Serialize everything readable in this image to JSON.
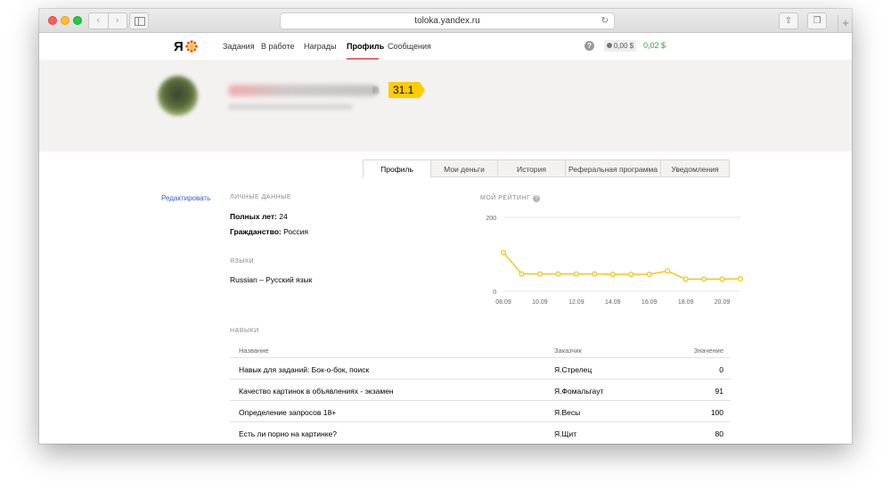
{
  "browser": {
    "url": "toloka.yandex.ru",
    "nav_back": "‹",
    "nav_forward": "›",
    "reload_glyph": "↻",
    "share_glyph": "⇧",
    "tabs_glyph": "❐",
    "new_tab_glyph": "+"
  },
  "header": {
    "logo": "Я",
    "nav": [
      "Задания",
      "В работе",
      "Награды",
      "Профиль",
      "Сообщения"
    ],
    "active_nav": "Профиль",
    "help": "?",
    "balance": "0,00 $",
    "earned": "0,02 $"
  },
  "profile": {
    "rating": "31.1",
    "name_suffix": "в",
    "tabs": [
      "Профиль",
      "Мои деньги",
      "История",
      "Реферальная программа",
      "Уведомления"
    ],
    "active_tab": "Профиль"
  },
  "sidebar": {
    "edit": "Редактировать"
  },
  "personal": {
    "label": "Личные данные",
    "age_label": "Полных лет:",
    "age_value": "24",
    "citizenship_label": "Гражданство:",
    "citizenship_value": "Россия"
  },
  "languages": {
    "label": "Языки",
    "value": "Russian – Русский язык"
  },
  "rating_chart_label": "Мой рейтинг",
  "chart_data": {
    "type": "line",
    "title": "Мой рейтинг",
    "x": [
      "08.09",
      "09.09",
      "10.09",
      "11.09",
      "12.09",
      "13.09",
      "14.09",
      "15.09",
      "16.09",
      "17.09",
      "18.09",
      "19.09",
      "20.09",
      "21.09"
    ],
    "x_tick_labels": [
      "08.09",
      "10.09",
      "12.09",
      "14.09",
      "16.09",
      "18.09",
      "20.09"
    ],
    "y_tick_labels": [
      "200",
      "0"
    ],
    "values": [
      105,
      47,
      47,
      47,
      47,
      47,
      46,
      46,
      46,
      55,
      33,
      33,
      33,
      34
    ],
    "ylim": [
      0,
      200
    ],
    "grid": true,
    "color": "#f5c518"
  },
  "skills": {
    "label": "Навыки",
    "columns": [
      "Название",
      "Заказчик",
      "Значение"
    ],
    "rows": [
      {
        "name": "Навык для заданий: Бок-о-бок, поиск",
        "customer": "Я.Стрелец",
        "value": "0"
      },
      {
        "name": "Качество картинок в объявлениях - экзамен",
        "customer": "Я.Фомальгаут",
        "value": "91"
      },
      {
        "name": "Определение запросов 18+",
        "customer": "Я.Весы",
        "value": "100"
      },
      {
        "name": "Есть ли порно на картинке?",
        "customer": "Я.Щит",
        "value": "80"
      }
    ]
  }
}
